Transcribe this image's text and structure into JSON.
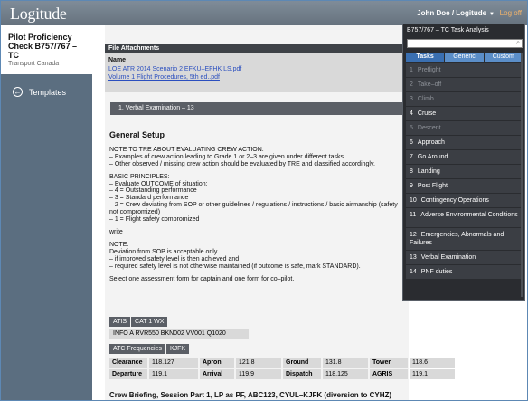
{
  "topbar": {
    "logo": "Logitude",
    "user": "John Doe / Logitude",
    "caret": "▼",
    "logoff": "Log off"
  },
  "sidebar": {
    "title": "Pilot Proficiency Check B757/767 – TC",
    "subtitle": "Transport Canada",
    "templates_label": "Templates",
    "templates_icon": "←"
  },
  "attachments": {
    "header": "File Attachments",
    "name_label": "Name",
    "files": [
      "LOE ATR 2014 Scenario 2 EFKU–EFHK LS.pdf",
      "Volume 1 Flight Procedures, 5th ed..pdf"
    ]
  },
  "section_bar": "1.   Verbal Examination – 13",
  "content": {
    "heading": "General Setup",
    "p1": "NOTE TO TRE ABOUT EVALUATING CREW ACTION:\n– Examples of crew action leading to Grade 1 or 2–3 are given under different tasks.\n– Other observed / missing crew action should be evaluated by TRE and classified accordingly.",
    "p2": "BASIC PRINCIPLES:\n– Evaluate OUTCOME of situation:\n– 4 = Outstanding performance\n– 3 = Standard performance\n– 2 = Crew deviating from SOP or other guidelines / regulations / instructions / basic airmanship (safety not compromized)\n– 1 = Flight safety compromized",
    "p3": "write",
    "p4": "NOTE:\nDeviation from SOP is acceptable only\n– if improved safety level is then achieved and\n– required safety level is not otherwise maintained (if outcome is safe, mark STANDARD).",
    "p5": "Select one assessment form for captain and one form for co–pilot."
  },
  "atis": {
    "label": "ATIS",
    "cat": "CAT 1 WX",
    "info": "INFO A RVR550 BKN002 VV001 Q1020"
  },
  "atc": {
    "label": "ATC Frequencies",
    "airport": "KJFK",
    "rows": [
      [
        [
          "Clearance",
          "118.127"
        ],
        [
          "Apron",
          "121.8"
        ],
        [
          "Ground",
          "131.8"
        ],
        [
          "Tower",
          "118.6"
        ]
      ],
      [
        [
          "Departure",
          "119.1"
        ],
        [
          "Arrival",
          "119.9"
        ],
        [
          "Dispatch",
          "118.125"
        ],
        [
          "AGRIS",
          "119.1"
        ]
      ]
    ]
  },
  "brief": "Crew Briefing, Session Part 1, LP as PF, ABC123, CYUL–KJFK (diversion to CYHZ)",
  "task_panel": {
    "title": "B757/767 – TC Task Analysis",
    "search_value": "",
    "search_icon": "magnifier-icon",
    "tabs": [
      "Tasks",
      "Generic",
      "Custom"
    ],
    "items": [
      {
        "num": "1",
        "label": "Preflight",
        "dim": true
      },
      {
        "num": "2",
        "label": "Take–off",
        "dim": true
      },
      {
        "num": "3",
        "label": "Climb",
        "dim": true
      },
      {
        "num": "4",
        "label": "Cruise",
        "dim": false
      },
      {
        "num": "5",
        "label": "Descent",
        "dim": true
      },
      {
        "num": "6",
        "label": "Approach",
        "dim": false
      },
      {
        "num": "7",
        "label": "Go Around",
        "dim": false
      },
      {
        "num": "8",
        "label": "Landing",
        "dim": false
      },
      {
        "num": "9",
        "label": "Post Flight",
        "dim": false
      },
      {
        "num": "10",
        "label": "Contingency Operations",
        "dim": false
      },
      {
        "num": "11",
        "label": "Adverse Environmental Conditions",
        "dim": false
      },
      {
        "num": "12",
        "label": "Emergencies, Abnormals and Failures",
        "dim": false
      },
      {
        "num": "13",
        "label": "Verbal Examination",
        "dim": false
      },
      {
        "num": "14",
        "label": "PNF duties",
        "dim": false
      }
    ]
  }
}
